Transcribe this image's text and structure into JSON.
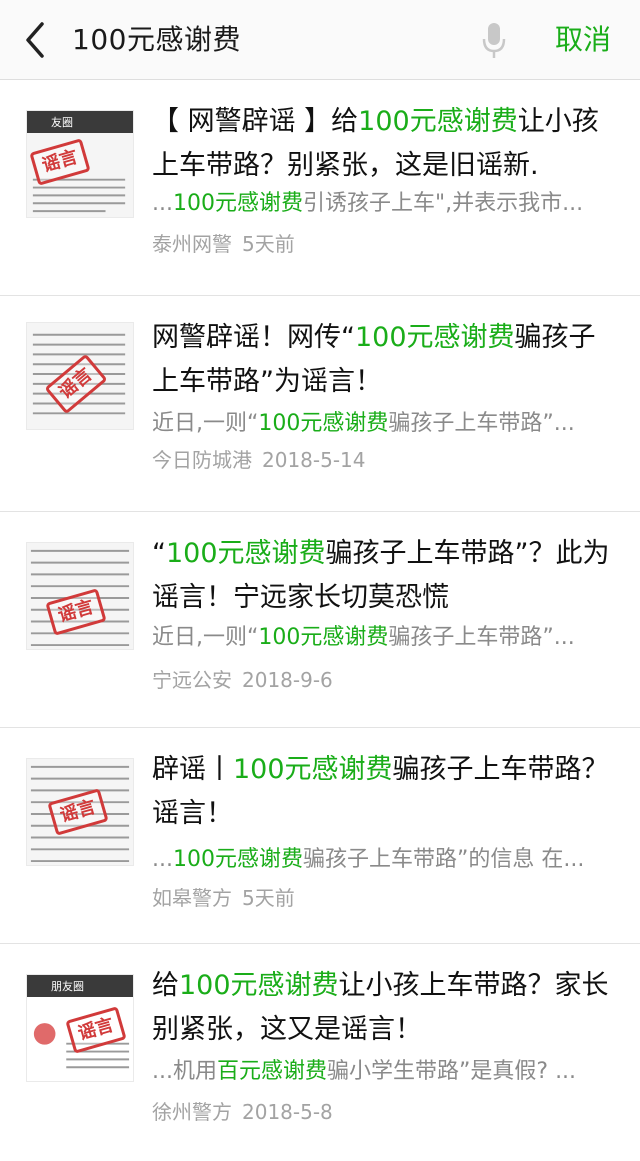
{
  "search": {
    "query": "100元感谢费",
    "cancel_label": "取消"
  },
  "colors": {
    "accent": "#1aad19",
    "snippet_gray": "#8a8a8a",
    "meta_gray": "#a3a3a3",
    "stamp_red": "#d13a3a"
  },
  "icons": {
    "back": "chevron-left-icon",
    "mic": "microphone-icon"
  },
  "results": [
    {
      "title_parts": [
        "【 网警辟谣 】给",
        "100元感谢费",
        "让小孩上车带路？别紧张，这是旧谣新."
      ],
      "snippet_parts": [
        "...",
        "100元感谢费",
        "引诱孩子上车\",并表示我市..."
      ],
      "source": "泰州网警",
      "time": "5天前",
      "thumb_stamp": "谣言",
      "thumb_bar": "友圈"
    },
    {
      "title_parts": [
        "网警辟谣！网传“",
        "100元感谢费",
        "骗孩子上车带路”为谣言！"
      ],
      "snippet_parts": [
        "近日,一则“",
        "100元感谢费",
        "骗孩子上车带路”..."
      ],
      "source": "今日防城港",
      "time": "2018-5-14",
      "thumb_stamp": "谣言",
      "thumb_bar": ""
    },
    {
      "title_parts": [
        "“",
        "100元感谢费",
        "骗孩子上车带路”？此为谣言！宁远家长切莫恐慌"
      ],
      "snippet_parts": [
        "近日,一则“",
        "100元感谢费",
        "骗孩子上车带路”..."
      ],
      "source": "宁远公安",
      "time": "2018-9-6",
      "thumb_stamp": "谣言",
      "thumb_bar": ""
    },
    {
      "title_parts": [
        "辟谣丨",
        "100元感谢费",
        "骗孩子上车带路？谣言！"
      ],
      "snippet_parts": [
        "...",
        "100元感谢费",
        "骗孩子上车带路”的信息 在..."
      ],
      "source": "如皋警方",
      "time": "5天前",
      "thumb_stamp": "谣言",
      "thumb_bar": ""
    },
    {
      "title_parts": [
        "给",
        "100元感谢费",
        "让小孩上车带路？家长别紧张，这又是谣言！"
      ],
      "snippet_parts": [
        "...机用",
        "百元感谢费",
        "骗小学生带路”是真假? ..."
      ],
      "source": "徐州警方",
      "time": "2018-5-8",
      "thumb_stamp": "谣言",
      "thumb_bar": "朋友圈"
    }
  ]
}
